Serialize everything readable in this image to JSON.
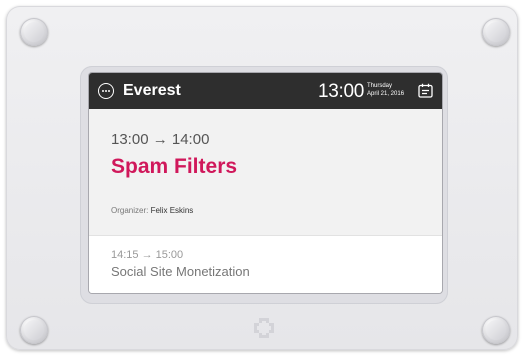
{
  "header": {
    "room_name": "Everest",
    "time": "13:00",
    "weekday": "Thursday",
    "date": "April 21, 2016",
    "menu_icon": "more-icon",
    "calendar_icon": "calendar-icon"
  },
  "current_meeting": {
    "time_range": "13:00 → 14:00",
    "title": "Spam Filters",
    "organizer_label": "Organizer:",
    "organizer_name": "Felix Eskins"
  },
  "next_meeting": {
    "time_range": "14:15 → 15:00",
    "title": "Social Site Monetization"
  },
  "colors": {
    "accent": "#d0185b",
    "header_bg": "#2e2e2e",
    "screen_bg": "#f1f1f1"
  },
  "brand_icon": "logo-icon"
}
